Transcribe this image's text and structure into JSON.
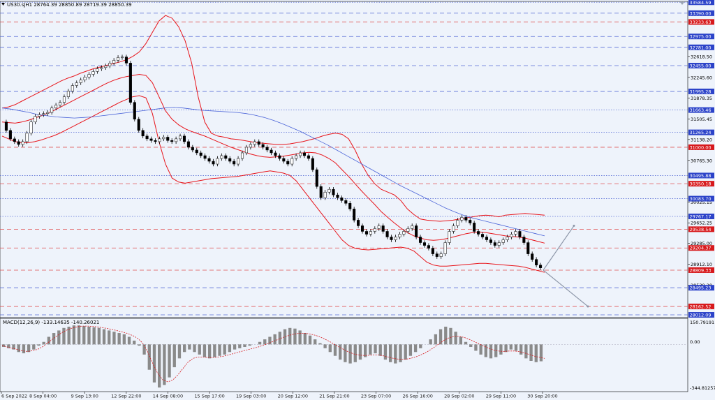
{
  "header": {
    "symbol_line": "US30.sJH1 28764.39 28850.89 28719.39 28850.39"
  },
  "macd": {
    "label": "MACD(12,26,9) -133.14635 -140.26021",
    "top_tick": "150.79191",
    "zero_tick": "0.00",
    "bottom_tick": "-344.81257"
  },
  "colors": {
    "background": "#eef3fb",
    "candle": "#000000",
    "bollinger": "#e8141a",
    "ma_blue": "#4a63d8",
    "line_blue": "#5a6fd6",
    "line_red": "#e05252",
    "tag_blue": "#2c43c9",
    "tag_red": "#d7191c",
    "macd_hist": "#8a8a8a",
    "macd_signal": "#d7191c",
    "arrow": "#8c96a8"
  },
  "chart_data": {
    "type": "candlestick",
    "symbol": "US30.sJH1",
    "timeframe": "H1",
    "ohlc_last": {
      "open": 28764.39,
      "high": 28850.89,
      "low": 28719.39,
      "close": 28850.39
    },
    "x_ticks": [
      "6 Sep 2022",
      "8 Sep 04:00",
      "9 Sep 13:00",
      "12 Sep 22:00",
      "14 Sep 08:00",
      "15 Sep 17:00",
      "19 Sep 03:00",
      "20 Sep 12:00",
      "21 Sep 21:00",
      "23 Sep 07:00",
      "26 Sep 16:00",
      "28 Sep 02:00",
      "29 Sep 11:00",
      "30 Sep 20:00"
    ],
    "y_range": [
      27950,
      33650
    ],
    "price_ticks": [
      "32618.50",
      "32245.60",
      "31878.35",
      "31505.45",
      "31138.20",
      "30765.30",
      "30025.15",
      "29652.25",
      "29285.00",
      "28912.10",
      "28539.20"
    ],
    "price_ticks_values": [
      32618.5,
      32245.6,
      31878.35,
      31505.45,
      31138.2,
      30765.3,
      30025.15,
      29652.25,
      29285.0,
      28912.1,
      28539.2
    ],
    "level_tags": [
      {
        "label": "33584.59",
        "value": 33584.59,
        "color": "blue",
        "style": "dotted"
      },
      {
        "label": "33390.00",
        "value": 33390.0,
        "color": "blue",
        "style": "dashed"
      },
      {
        "label": "33233.63",
        "value": 33233.63,
        "color": "red",
        "style": "dashed"
      },
      {
        "label": "32975.00",
        "value": 32975.0,
        "color": "blue",
        "style": "dashed"
      },
      {
        "label": "32781.00",
        "value": 32781.0,
        "color": "blue",
        "style": "dashed"
      },
      {
        "label": "32455.00",
        "value": 32455.0,
        "color": "blue",
        "style": "dashed"
      },
      {
        "label": "31995.28",
        "value": 31995.28,
        "color": "blue",
        "style": "dashed"
      },
      {
        "label": "31663.46",
        "value": 31663.46,
        "color": "blue",
        "style": "dotted"
      },
      {
        "label": "31265.24",
        "value": 31265.24,
        "color": "blue",
        "style": "dotted"
      },
      {
        "label": "31000.00",
        "value": 31000.0,
        "color": "red",
        "style": "dashed"
      },
      {
        "label": "30495.88",
        "value": 30495.88,
        "color": "blue",
        "style": "dotted"
      },
      {
        "label": "30350.18",
        "value": 30350.18,
        "color": "red",
        "style": "dashed"
      },
      {
        "label": "30083.70",
        "value": 30083.7,
        "color": "blue",
        "style": "dotted"
      },
      {
        "label": "29767.17",
        "value": 29767.17,
        "color": "blue",
        "style": "dotted"
      },
      {
        "label": "29538.54",
        "value": 29538.54,
        "color": "red",
        "style": "dashed"
      },
      {
        "label": "29204.37",
        "value": 29204.37,
        "color": "red",
        "style": "dashed"
      },
      {
        "label": "28809.33",
        "value": 28809.33,
        "color": "red",
        "style": "dashed"
      },
      {
        "label": "28495.23",
        "value": 28495.23,
        "color": "blue",
        "style": "dashed"
      },
      {
        "label": "28162.52",
        "value": 28162.52,
        "color": "red",
        "style": "dashed"
      },
      {
        "label": "28012.09",
        "value": 28012.09,
        "color": "blue",
        "style": "dashed"
      }
    ],
    "close_path": [
      31450,
      31300,
      31150,
      31100,
      31050,
      31100,
      31250,
      31450,
      31550,
      31580,
      31600,
      31620,
      31700,
      31750,
      31800,
      31900,
      32000,
      32100,
      32150,
      32200,
      32250,
      32300,
      32350,
      32400,
      32420,
      32450,
      32500,
      32550,
      32600,
      32610,
      32500,
      31800,
      31500,
      31300,
      31200,
      31150,
      31120,
      31100,
      31150,
      31180,
      31120,
      31100,
      31150,
      31200,
      31100,
      31000,
      30950,
      30900,
      30850,
      30800,
      30750,
      30700,
      30800,
      30850,
      30800,
      30750,
      30700,
      30800,
      30900,
      31000,
      31050,
      31100,
      31050,
      31000,
      30950,
      30900,
      30850,
      30800,
      30750,
      30700,
      30800,
      30850,
      30900,
      30850,
      30800,
      30600,
      30300,
      30100,
      30200,
      30250,
      30150,
      30100,
      30050,
      30000,
      29900,
      29700,
      29600,
      29500,
      29450,
      29500,
      29550,
      29600,
      29500,
      29400,
      29350,
      29400,
      29450,
      29500,
      29550,
      29600,
      29400,
      29300,
      29250,
      29200,
      29100,
      29050,
      29100,
      29300,
      29500,
      29600,
      29700,
      29750,
      29700,
      29650,
      29500,
      29450,
      29400,
      29350,
      29300,
      29250,
      29300,
      29350,
      29400,
      29450,
      29500,
      29400,
      29300,
      29100,
      29000,
      28900,
      28850
    ],
    "bollinger_upper": [
      31700,
      31720,
      31760,
      31820,
      31880,
      31940,
      32000,
      32060,
      32120,
      32180,
      32230,
      32270,
      32320,
      32360,
      32400,
      32430,
      32460,
      32490,
      32520,
      32560,
      32620,
      32700,
      32850,
      33050,
      33250,
      33350,
      33300,
      33150,
      32900,
      32500,
      31900,
      31450,
      31250,
      31200,
      31180,
      31150,
      31140,
      31120,
      31100,
      31080,
      31070,
      31060,
      31050,
      31050,
      31060,
      31080,
      31100,
      31130,
      31160,
      31200,
      31230,
      31250,
      31230,
      31150,
      30950,
      30700,
      30500,
      30350,
      30250,
      30200,
      30150,
      30050,
      29900,
      29800,
      29720,
      29700,
      29690,
      29680,
      29690,
      29700,
      29720,
      29740,
      29760,
      29780,
      29790,
      29780,
      29760,
      29790,
      29800,
      29810,
      29820,
      29810,
      29800,
      29790
    ],
    "bollinger_middle": [
      31450,
      31440,
      31430,
      31450,
      31480,
      31520,
      31560,
      31610,
      31660,
      31720,
      31780,
      31840,
      31900,
      31960,
      32020,
      32080,
      32140,
      32190,
      32230,
      32260,
      32280,
      32300,
      32280,
      32150,
      31900,
      31650,
      31500,
      31400,
      31330,
      31280,
      31240,
      31200,
      31150,
      31100,
      31050,
      31000,
      30960,
      30920,
      30880,
      30850,
      30830,
      30820,
      30830,
      30840,
      30860,
      30880,
      30900,
      30910,
      30900,
      30860,
      30800,
      30720,
      30600,
      30480,
      30350,
      30220,
      30100,
      29980,
      29850,
      29750,
      29650,
      29560,
      29480,
      29420,
      29380,
      29350,
      29340,
      29350,
      29370,
      29400,
      29430,
      29460,
      29480,
      29490,
      29480,
      29460,
      29440,
      29420,
      29410,
      29400,
      29380,
      29350,
      29320,
      29290
    ],
    "bollinger_lower": [
      31200,
      31150,
      31100,
      31080,
      31080,
      31100,
      31130,
      31170,
      31210,
      31260,
      31320,
      31380,
      31440,
      31500,
      31560,
      31620,
      31680,
      31740,
      31800,
      31850,
      31900,
      31920,
      31880,
      31600,
      31100,
      30700,
      30450,
      30380,
      30360,
      30380,
      30400,
      30420,
      30440,
      30450,
      30460,
      30470,
      30480,
      30500,
      30520,
      30540,
      30560,
      30580,
      30560,
      30540,
      30500,
      30400,
      30250,
      30100,
      29950,
      29800,
      29650,
      29500,
      29350,
      29250,
      29200,
      29180,
      29170,
      29180,
      29190,
      29200,
      29210,
      29220,
      29200,
      29150,
      29050,
      28950,
      28900,
      28880,
      28880,
      28890,
      28900,
      28910,
      28920,
      28930,
      28930,
      28920,
      28910,
      28900,
      28890,
      28880,
      28860,
      28830,
      28800,
      28770
    ],
    "ma_blue": [
      31700,
      31680,
      31650,
      31620,
      31580,
      31560,
      31540,
      31530,
      31520,
      31530,
      31540,
      31560,
      31580,
      31600,
      31620,
      31640,
      31660,
      31680,
      31700,
      31710,
      31700,
      31680,
      31660,
      31650,
      31640,
      31630,
      31620,
      31600,
      31570,
      31530,
      31480,
      31420,
      31350,
      31280,
      31200,
      31120,
      31040,
      30950,
      30860,
      30770,
      30680,
      30590,
      30500,
      30410,
      30320,
      30240,
      30160,
      30080,
      30000,
      29920,
      29850,
      29790,
      29740,
      29700,
      29660,
      29620,
      29580,
      29540,
      29500,
      29460,
      29420
    ],
    "projection": [
      {
        "from": 28809.33,
        "to": 29600.0
      },
      {
        "from": 28809.33,
        "to": 28162.52
      }
    ],
    "macd": {
      "signal_name": "MACD(12,26,9)",
      "macd_value": -133.14635,
      "signal_value": -140.26021,
      "range": [
        -344.81257,
        150.79191
      ],
      "histogram": [
        -20,
        -30,
        -40,
        -60,
        -70,
        -60,
        -40,
        -10,
        20,
        60,
        90,
        110,
        130,
        140,
        150,
        150,
        145,
        140,
        135,
        130,
        120,
        110,
        100,
        90,
        80,
        60,
        30,
        -10,
        -80,
        -200,
        -300,
        -340,
        -320,
        -260,
        -180,
        -110,
        -60,
        -40,
        -60,
        -80,
        -100,
        -110,
        -100,
        -90,
        -80,
        -60,
        -40,
        -30,
        -20,
        -10,
        0,
        20,
        40,
        60,
        80,
        100,
        120,
        130,
        125,
        110,
        90,
        70,
        40,
        10,
        -30,
        -60,
        -90,
        -120,
        -140,
        -150,
        -140,
        -120,
        -100,
        -80,
        -70,
        -90,
        -120,
        -140,
        -150,
        -140,
        -120,
        -90,
        -60,
        -30,
        0,
        40,
        80,
        120,
        140,
        130,
        100,
        60,
        20,
        -20,
        -50,
        -80,
        -100,
        -110,
        -100,
        -80,
        -60,
        -40,
        -50,
        -80,
        -110,
        -130,
        -140,
        -133
      ],
      "signal": [
        -10,
        -20,
        -30,
        -40,
        -50,
        -55,
        -50,
        -40,
        -20,
        10,
        40,
        70,
        95,
        115,
        130,
        140,
        145,
        145,
        142,
        138,
        132,
        125,
        117,
        108,
        98,
        86,
        70,
        48,
        10,
        -60,
        -150,
        -230,
        -280,
        -295,
        -280,
        -240,
        -190,
        -140,
        -110,
        -100,
        -100,
        -103,
        -103,
        -99,
        -93,
        -84,
        -73,
        -62,
        -51,
        -41,
        -31,
        -20,
        -7,
        8,
        24,
        40,
        56,
        70,
        81,
        87,
        88,
        84,
        76,
        64,
        47,
        27,
        5,
        -18,
        -40,
        -60,
        -75,
        -84,
        -87,
        -86,
        -83,
        -84,
        -91,
        -101,
        -111,
        -117,
        -118,
        -113,
        -103,
        -89,
        -71,
        -49,
        -23,
        6,
        33,
        53,
        63,
        63,
        55,
        40,
        22,
        3,
        -15,
        -32,
        -46,
        -53,
        -55,
        -52,
        -52,
        -57,
        -67,
        -80,
        -93,
        -102,
        -110
      ]
    }
  }
}
